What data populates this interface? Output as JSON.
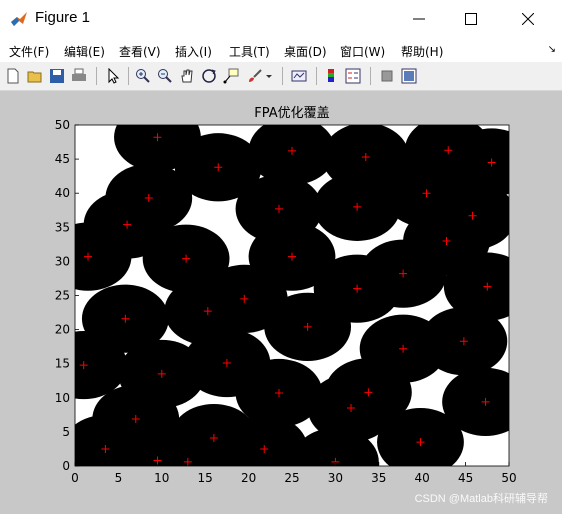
{
  "window": {
    "title": "Figure 1",
    "minimize_glyph": "—",
    "maximize_glyph": "☐",
    "close_glyph": "✕"
  },
  "menu": {
    "items": [
      "文件(F)",
      "编辑(E)",
      "查看(V)",
      "插入(I)",
      "工具(T)",
      "桌面(D)",
      "窗口(W)",
      "帮助(H)"
    ],
    "overflow_glyph": "↘"
  },
  "toolbar": {
    "icons": [
      "new-figure-icon",
      "open-file-icon",
      "save-icon",
      "print-icon",
      "edit-plot-arrow-icon",
      "zoom-in-icon",
      "zoom-out-icon",
      "pan-hand-icon",
      "rotate-3d-icon",
      "data-cursor-icon",
      "brush-icon",
      "link-plot-icon",
      "colorbar-icon",
      "legend-icon",
      "hide-plot-tools-icon",
      "show-plot-tools-icon"
    ]
  },
  "chart_data": {
    "type": "scatter",
    "title": "FPA优化覆盖",
    "xlabel": "",
    "ylabel": "",
    "xlim": [
      0,
      50
    ],
    "ylim": [
      0,
      50
    ],
    "xticks": [
      0,
      5,
      10,
      15,
      20,
      25,
      30,
      35,
      40,
      45,
      50
    ],
    "yticks": [
      0,
      5,
      10,
      15,
      20,
      25,
      30,
      35,
      40,
      45,
      50
    ],
    "grid": false,
    "coverage_radius": 5,
    "circle_color": "#000000",
    "marker": "+",
    "marker_color": "#ff0000",
    "background_color": "#ffffff",
    "points": [
      [
        9.5,
        48.2
      ],
      [
        16.5,
        43.8
      ],
      [
        25,
        46.2
      ],
      [
        33.5,
        45.3
      ],
      [
        43,
        46.3
      ],
      [
        48,
        44.5
      ],
      [
        8.5,
        39.3
      ],
      [
        23.5,
        37.7
      ],
      [
        32.5,
        38
      ],
      [
        40.5,
        40
      ],
      [
        45.8,
        36.7
      ],
      [
        6,
        35.4
      ],
      [
        1.5,
        30.7
      ],
      [
        12.8,
        30.4
      ],
      [
        25,
        30.7
      ],
      [
        37.8,
        28.2
      ],
      [
        42.8,
        33
      ],
      [
        47.5,
        26.3
      ],
      [
        19.5,
        24.5
      ],
      [
        32.5,
        26
      ],
      [
        5.8,
        21.6
      ],
      [
        15.3,
        22.7
      ],
      [
        26.8,
        20.4
      ],
      [
        44.8,
        18.3
      ],
      [
        1,
        14.8
      ],
      [
        10,
        13.5
      ],
      [
        17.5,
        15.1
      ],
      [
        37.8,
        17.2
      ],
      [
        23.5,
        10.7
      ],
      [
        33.8,
        10.8
      ],
      [
        31.8,
        8.5
      ],
      [
        7,
        6.9
      ],
      [
        47.3,
        9.4
      ],
      [
        16,
        4.1
      ],
      [
        3.5,
        2.5
      ],
      [
        9.5,
        0.8
      ],
      [
        13,
        0.6
      ],
      [
        21.8,
        2.5
      ],
      [
        30,
        0.6
      ],
      [
        39.8,
        3.5
      ]
    ]
  },
  "watermark": "CSDN @Matlab科研辅导帮"
}
